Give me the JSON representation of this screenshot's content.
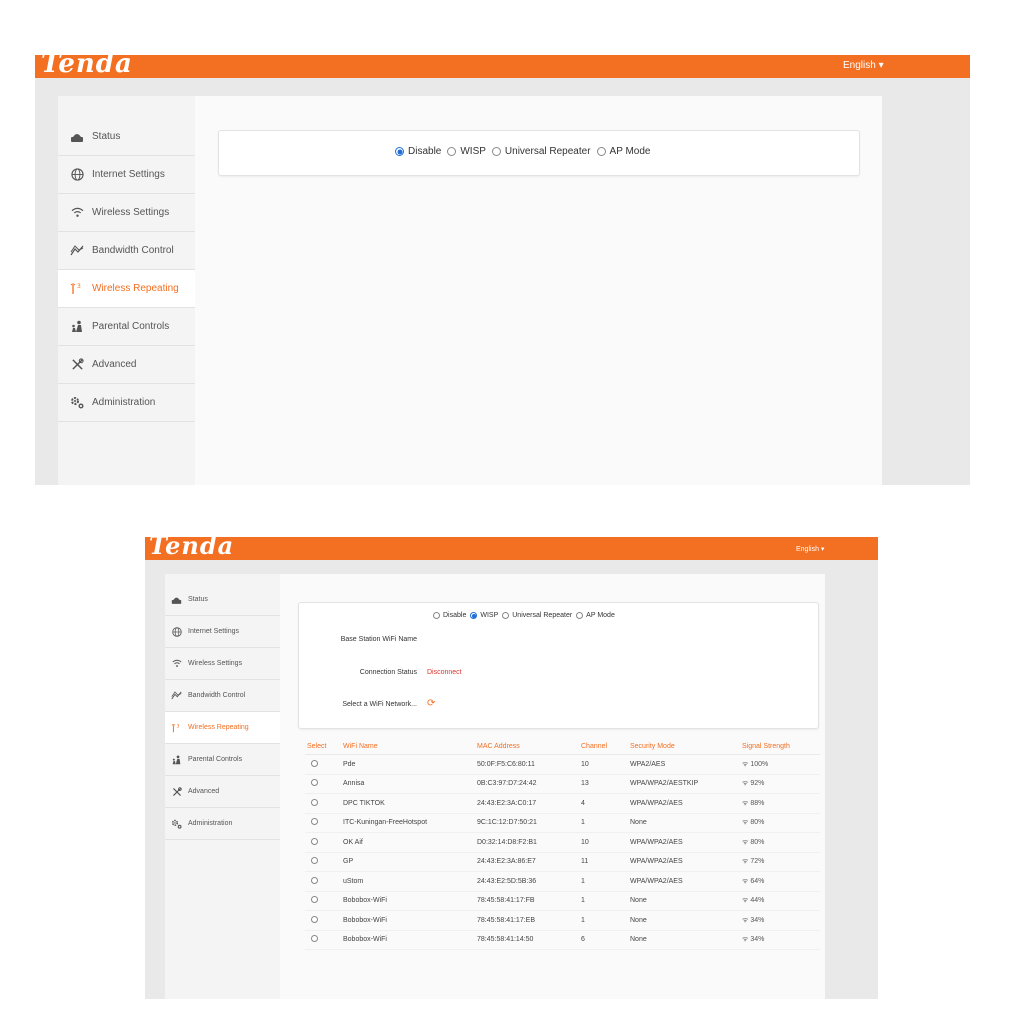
{
  "brand": {
    "logo": "Tenda",
    "accent": "#f36f21"
  },
  "language": "English ▾",
  "nav": [
    {
      "label": "Status",
      "icon": "status-icon"
    },
    {
      "label": "Internet Settings",
      "icon": "globe-icon"
    },
    {
      "label": "Wireless Settings",
      "icon": "wifi-icon"
    },
    {
      "label": "Bandwidth Control",
      "icon": "bandwidth-icon"
    },
    {
      "label": "Wireless Repeating",
      "icon": "repeater-antenna-icon"
    },
    {
      "label": "Parental Controls",
      "icon": "parental-icon"
    },
    {
      "label": "Advanced",
      "icon": "tools-icon"
    },
    {
      "label": "Administration",
      "icon": "gear-icon"
    }
  ],
  "modes": [
    "Disable",
    "WISP",
    "Universal Repeater",
    "AP Mode"
  ],
  "screen1": {
    "selected_mode": "Disable"
  },
  "screen2": {
    "selected_mode": "WISP",
    "base_station_label": "Base Station WiFi Name",
    "connection_status_label": "Connection Status",
    "connection_status_value": "Disconnect",
    "select_network_label": "Select a WiFi Network...",
    "columns": [
      "Select",
      "WiFi Name",
      "MAC Address",
      "Channel",
      "Security Mode",
      "Signal Strength"
    ],
    "rows": [
      {
        "name": "Pde",
        "mac": "50:0F:F5:C6:80:11",
        "channel": "10",
        "security": "WPA2/AES",
        "signal": "100%"
      },
      {
        "name": "Annisa",
        "mac": "0B:C3:97:D7:24:42",
        "channel": "13",
        "security": "WPA/WPA2/AESTKIP",
        "signal": "92%"
      },
      {
        "name": "DPC TIKTOK",
        "mac": "24:43:E2:3A:C0:17",
        "channel": "4",
        "security": "WPA/WPA2/AES",
        "signal": "88%"
      },
      {
        "name": "ITC-Kuningan-FreeHotspot",
        "mac": "9C:1C:12:D7:50:21",
        "channel": "1",
        "security": "None",
        "signal": "80%"
      },
      {
        "name": "OK Aif",
        "mac": "D0:32:14:D8:F2:B1",
        "channel": "10",
        "security": "WPA/WPA2/AES",
        "signal": "80%"
      },
      {
        "name": "GP",
        "mac": "24:43:E2:3A:86:E7",
        "channel": "11",
        "security": "WPA/WPA2/AES",
        "signal": "72%"
      },
      {
        "name": "uStom",
        "mac": "24:43:E2:5D:5B:36",
        "channel": "1",
        "security": "WPA/WPA2/AES",
        "signal": "64%"
      },
      {
        "name": "Bobobox-WiFi",
        "mac": "78:45:58:41:17:FB",
        "channel": "1",
        "security": "None",
        "signal": "44%"
      },
      {
        "name": "Bobobox-WiFi",
        "mac": "78:45:58:41:17:EB",
        "channel": "1",
        "security": "None",
        "signal": "34%"
      },
      {
        "name": "Bobobox-WiFi",
        "mac": "78:45:58:41:14:50",
        "channel": "6",
        "security": "None",
        "signal": "34%"
      }
    ]
  }
}
